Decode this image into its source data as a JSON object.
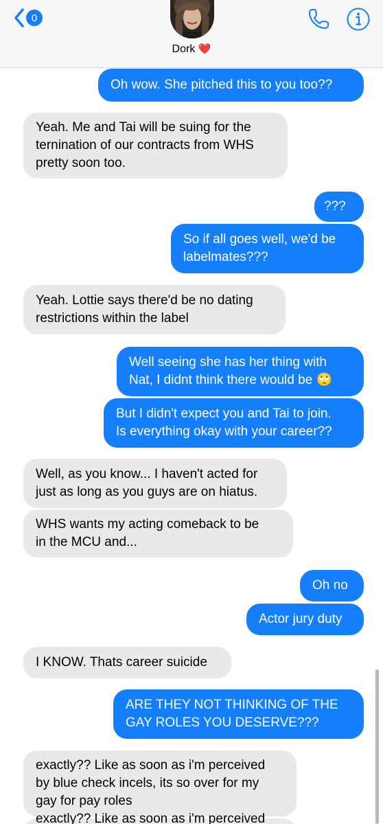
{
  "header": {
    "unread_count": "0",
    "contact_name": "Dork",
    "name_emoji": "❤️"
  },
  "colors": {
    "sent_bubble": "#157efb",
    "received_bubble": "#e9e9eb",
    "accent": "#157efb"
  },
  "messages": [
    {
      "from": "me",
      "text": "Oh wow. She pitched this to you too??"
    },
    {
      "from": "them",
      "text": "Yeah. Me and Tai will be suing for the\nternination of our contracts from WHS\npretty soon too."
    },
    {
      "from": "me",
      "text": "???"
    },
    {
      "from": "me",
      "text": "So if all goes well, we'd be\nlabelmates???"
    },
    {
      "from": "them",
      "text": "Yeah. Lottie says there'd be no dating\nrestrictions within the label"
    },
    {
      "from": "me",
      "text": "Well seeing she has her thing with\nNat, I didnt think there would be 🙄"
    },
    {
      "from": "me",
      "text": "But I didn't expect you and Tai to join.\nIs everything okay with your career??"
    },
    {
      "from": "them",
      "text": "Well, as you know... I haven't acted for\njust as long as you guys are on hiatus."
    },
    {
      "from": "them",
      "text": "WHS wants my acting comeback to be\nin the MCU and..."
    },
    {
      "from": "me",
      "text": "Oh no"
    },
    {
      "from": "me",
      "text": "Actor jury duty"
    },
    {
      "from": "them",
      "text": "I KNOW. Thats career suicide"
    },
    {
      "from": "me",
      "text": "ARE THEY NOT THINKING OF THE\nGAY ROLES YOU DESERVE???"
    },
    {
      "from": "them",
      "text": "exactly?? Like as soon as i'm perceived\nby blue check incels, its so over for my\ngay for pay roles"
    },
    {
      "from": "them",
      "text": "exactly?? Like as soon as i'm perceived"
    }
  ]
}
